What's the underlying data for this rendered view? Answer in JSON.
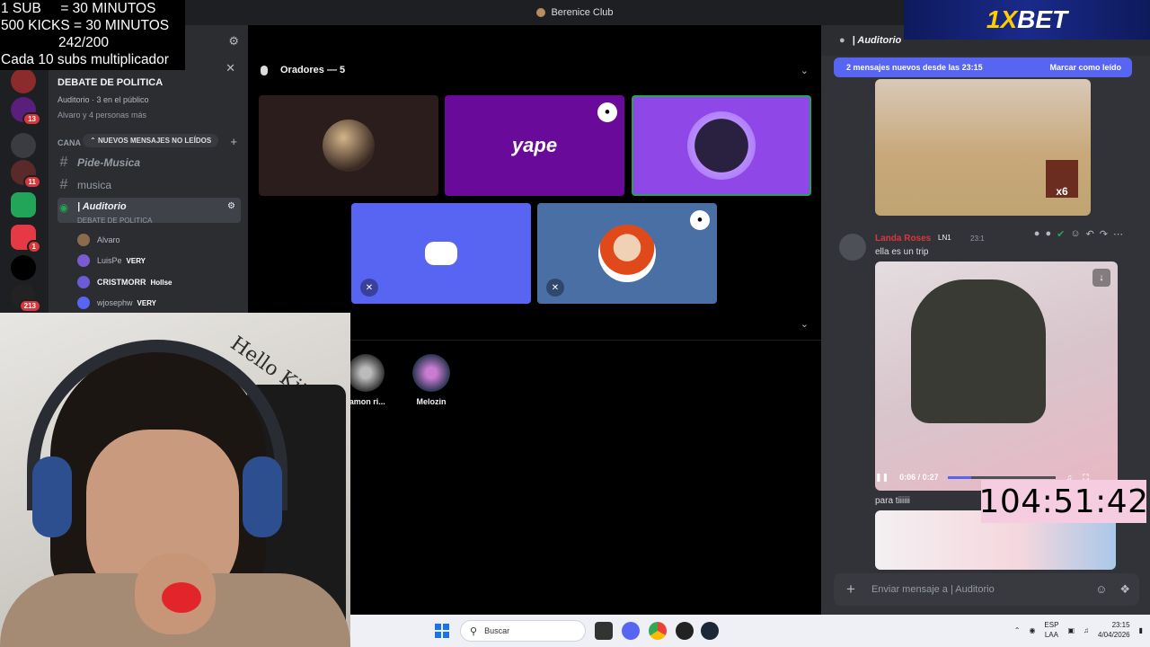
{
  "window": {
    "title": "Berenice Club"
  },
  "overlay": {
    "lines": [
      "1 SUB     = 30 MINUTOS",
      "500 KICKS = 30 MINUTOS",
      "242/200",
      "Cada 10 subs multiplicador"
    ]
  },
  "servers": [
    {
      "badge": ""
    },
    {
      "badge": "13"
    },
    {
      "badge": ""
    },
    {
      "badge": "11"
    },
    {
      "badge": ""
    },
    {
      "badge": "1"
    },
    {
      "badge": ""
    },
    {
      "badge": "213"
    }
  ],
  "sidebar": {
    "event_title": "DEBATE DE POLITICA",
    "event_sub": "Auditorio · 3 en el público",
    "event_sub2": "Alvaro y 4 personas más",
    "category": "CANA",
    "new_messages_pill": "NUEVOS MENSAJES NO LEÍDOS",
    "channels": [
      {
        "name": "Pide-Musica"
      },
      {
        "name": "musica"
      }
    ],
    "voice_channel": "| Auditorio",
    "voice_sub": "DEBATE DE POLITICA",
    "members": [
      {
        "name": "Alvaro",
        "tag": ""
      },
      {
        "name": "LuisPe",
        "tag": "VERY"
      },
      {
        "name": "CRISTMORR",
        "tag": "Hollse"
      },
      {
        "name": "wjosephw",
        "tag": "VERY"
      }
    ]
  },
  "stage": {
    "speakers_header": "Oradores — 5",
    "audience": [
      {
        "name": "ramon ri..."
      },
      {
        "name": "Melozin"
      }
    ],
    "tile_label_yape": "yape"
  },
  "chat": {
    "header": "| Auditorio",
    "new_bar_left": "2 mensajes nuevos desde las 23:15",
    "new_bar_right": "Marcar como leído",
    "msg1_author": "Landa Roses",
    "msg1_badge": "LN1",
    "msg1_time": "23:1",
    "msg1_text": "ella es un trip",
    "player_time": "0:06 / 0:27",
    "player_progress": 0.22,
    "msg2_text": "para tiiiiii",
    "composer_placeholder": "Enviar mensaje a | Auditorio",
    "media_badge": "x6"
  },
  "timer": {
    "value": "104:51:42"
  },
  "ad": {
    "brand_a": "1X",
    "brand_b": "BET"
  },
  "webcam": {
    "wall_text": "Hello Kit"
  },
  "taskbar": {
    "search_placeholder": "Buscar",
    "lang_top": "ESP",
    "lang_bottom": "LAA",
    "clock_time": "23:15",
    "clock_date": "4/04/2026"
  },
  "colors": {
    "discord_blurple": "#5865f2",
    "yape_purple": "#6a0a9a",
    "speaker_purple": "#8f47e8",
    "discord_tile": "#5865f2",
    "roblox_tile": "#4a6fa5",
    "timer_bg": "#f6cce0"
  }
}
